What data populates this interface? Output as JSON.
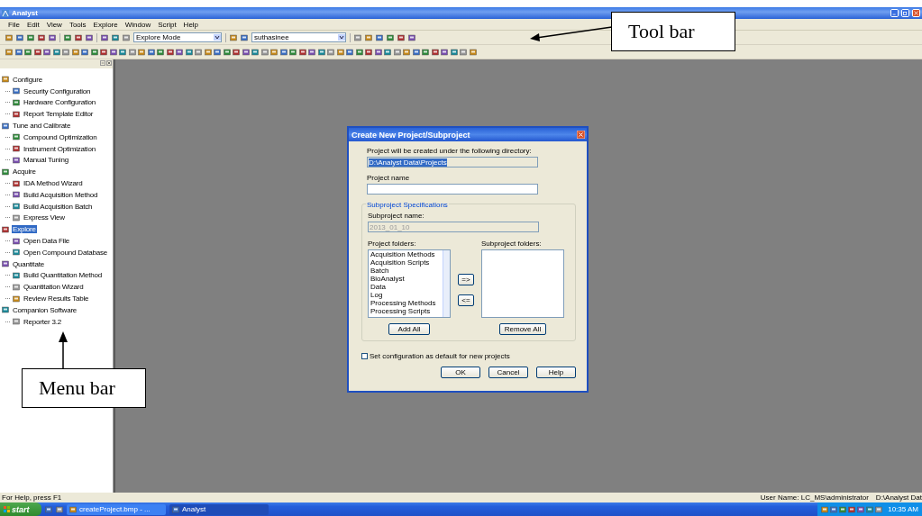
{
  "window": {
    "title": "Analyst"
  },
  "menu_bar": [
    "File",
    "Edit",
    "View",
    "Tools",
    "Explore",
    "Window",
    "Script",
    "Help"
  ],
  "toolbar": {
    "mode": "Explore Mode",
    "user": "suthasinee"
  },
  "sidebar": {
    "items": [
      {
        "label": "Configure",
        "selected": false,
        "children": [
          {
            "label": "Security Configuration",
            "selected": false
          },
          {
            "label": "Hardware Configuration",
            "selected": false
          },
          {
            "label": "Report Template Editor",
            "selected": false
          }
        ]
      },
      {
        "label": "Tune and Calibrate",
        "selected": false,
        "children": [
          {
            "label": "Compound Optimization",
            "selected": false
          },
          {
            "label": "Instrument Optimization",
            "selected": false
          },
          {
            "label": "Manual Tuning",
            "selected": false
          }
        ]
      },
      {
        "label": "Acquire",
        "selected": false,
        "children": [
          {
            "label": "IDA Method Wizard",
            "selected": false
          },
          {
            "label": "Build Acquisition Method",
            "selected": false
          },
          {
            "label": "Build Acquisition Batch",
            "selected": false
          },
          {
            "label": "Express View",
            "selected": false
          }
        ]
      },
      {
        "label": "Explore",
        "selected": true,
        "children": [
          {
            "label": "Open Data File",
            "selected": false
          },
          {
            "label": "Open Compound Database",
            "selected": false
          }
        ]
      },
      {
        "label": "Quantitate",
        "selected": false,
        "children": [
          {
            "label": "Build Quantitation Method",
            "selected": false
          },
          {
            "label": "Quantitation Wizard",
            "selected": false
          },
          {
            "label": "Review Results Table",
            "selected": false
          }
        ]
      },
      {
        "label": "Companion Software",
        "selected": false,
        "children": [
          {
            "label": "Reporter 3.2",
            "selected": false
          }
        ]
      }
    ]
  },
  "dialog": {
    "title": "Create New Project/Subproject",
    "directory_label": "Project will be created under the following directory:",
    "directory": "D:\\Analyst Data\\Projects",
    "project_name_label": "Project name",
    "group_title": "Subproject Specifications",
    "subproject_name_label": "Subproject name:",
    "subproject_name": "2013_01_10",
    "project_folders_label": "Project folders:",
    "project_folders": [
      "Acquisition Methods",
      "Acquisition Scripts",
      "Batch",
      "BioAnalyst",
      "Data",
      "Log",
      "Processing Methods",
      "Processing Scripts"
    ],
    "subproject_folders_label": "Subproject folders:",
    "move_right": "=>",
    "move_left": "<=",
    "add_all": "Add All",
    "remove_all": "Remove All",
    "default_checkbox": {
      "label": "Set configuration as default for new projects",
      "checked": false
    },
    "buttons": [
      "OK",
      "Cancel",
      "Help"
    ]
  },
  "status_bar": {
    "help": "For Help, press F1",
    "user": "User Name: LC_MS\\administrator",
    "path": "D:\\Analyst Dat"
  },
  "taskbar": {
    "start": "start",
    "tasks": [
      {
        "label": "createProject.bmp - ...",
        "selected": false
      },
      {
        "label": "Analyst",
        "selected": true
      }
    ],
    "clock": "10:35 AM"
  },
  "annotations": [
    {
      "label": "Tool bar",
      "kind": "toolbar"
    },
    {
      "label": "Menu bar",
      "kind": "menu"
    }
  ]
}
